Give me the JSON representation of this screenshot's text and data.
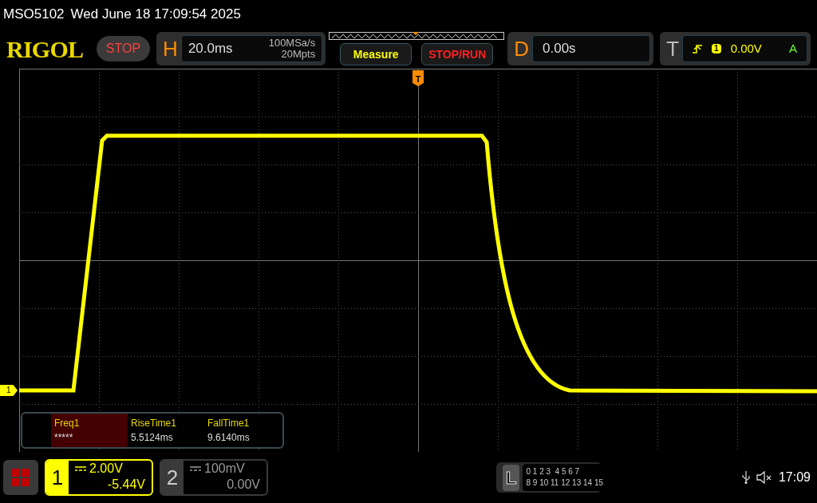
{
  "header": {
    "model": "MSO5102",
    "datetime": "Wed June 18 17:09:54 2025"
  },
  "toolbar": {
    "logo": "RIGOL",
    "run_state": "STOP",
    "horizontal": {
      "letter": "H",
      "timebase": "20.0ms",
      "sample_rate": "100MSa/s",
      "memory_depth": "20Mpts"
    },
    "buttons": [
      {
        "label": "Measure",
        "kind": "measure"
      },
      {
        "label": "STOP/RUN",
        "kind": "run"
      }
    ],
    "delay": {
      "letter": "D",
      "value": "0.00s"
    },
    "trigger": {
      "letter": "T",
      "source": "1",
      "level": "0.00V",
      "mode": "A"
    }
  },
  "display": {
    "trigger_marker": "T",
    "channel_marker": "1",
    "measurements": [
      {
        "name": "Freq1",
        "value": "*****",
        "selected": true
      },
      {
        "name": "RiseTime1",
        "value": "5.5124ms",
        "selected": false
      },
      {
        "name": "FallTime1",
        "value": "9.6140ms",
        "selected": false
      }
    ]
  },
  "bottom_bar": {
    "channels": [
      {
        "number": "1",
        "scale": "2.00V",
        "offset": "-5.44V",
        "on": true
      },
      {
        "number": "2",
        "scale": "100mV",
        "offset": "0.00V",
        "on": false
      }
    ],
    "logic": {
      "letter": "L",
      "rows": [
        "0 1 2 3  4 5 6 7",
        "8 9 10 11 12 13 14 15"
      ]
    },
    "time": "17:09"
  }
}
